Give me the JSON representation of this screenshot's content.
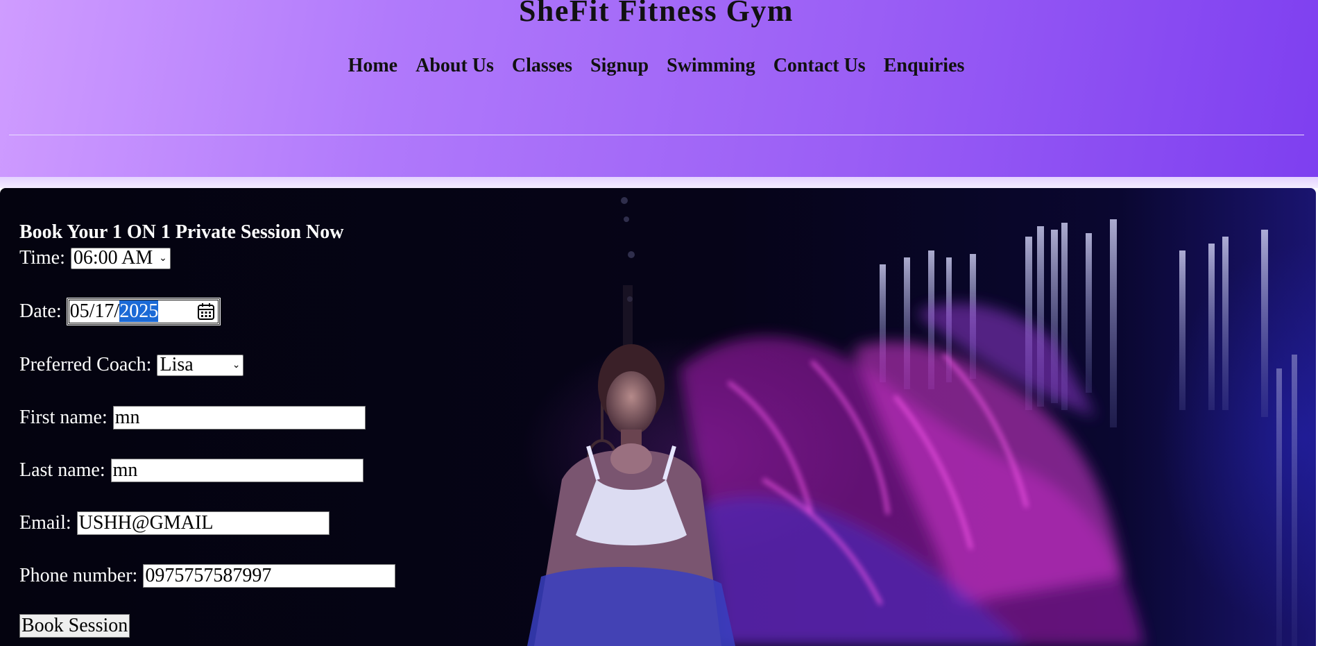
{
  "header": {
    "title": "SheFit Fitness Gym",
    "nav": [
      "Home",
      "About Us",
      "Classes",
      "Signup",
      "Swimming",
      "Contact Us",
      "Enquiries"
    ]
  },
  "booking": {
    "heading": "Book Your 1 ON 1 Private Session Now",
    "time": {
      "label": "Time:",
      "value": "06:00 AM"
    },
    "date": {
      "label": "Date:",
      "month_day": "05/17/",
      "year": "2025"
    },
    "coach": {
      "label": "Preferred Coach:",
      "value": "Lisa"
    },
    "first_name": {
      "label": "First name:",
      "value": "mn"
    },
    "last_name": {
      "label": "Last name:",
      "value": "mn"
    },
    "email": {
      "label": "Email:",
      "value": "USHH@GMAIL"
    },
    "phone": {
      "label": "Phone number:",
      "value": "0975757587997"
    },
    "submit_label": "Book Session"
  },
  "colors": {
    "header_gradient_start": "#cf9cff",
    "header_gradient_end": "#7e3ff0",
    "hero_background": "#04030f",
    "accent_magenta": "#e03ad8",
    "selection_blue": "#1b6ad6"
  },
  "icons": {
    "date_picker": "calendar-icon",
    "select_arrow": "chevron-down-icon"
  }
}
